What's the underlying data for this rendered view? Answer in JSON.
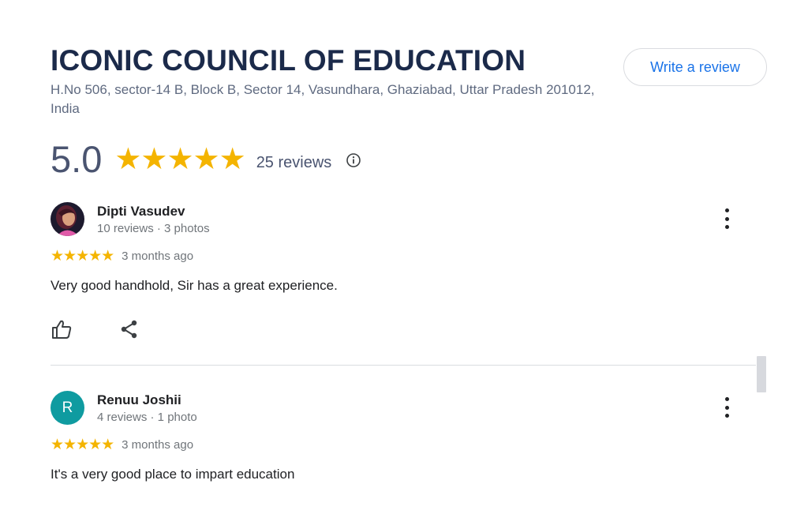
{
  "place": {
    "name": "ICONIC COUNCIL OF EDUCATION",
    "address": "H.No 506, sector-14 B, Block B, Sector 14, Vasundhara, Ghaziabad, Uttar Pradesh 201012, India"
  },
  "write_review_label": "Write a review",
  "rating": {
    "value": "5.0",
    "stars": "★★★★★",
    "count_label": "25 reviews",
    "info_icon": "info-icon"
  },
  "reviews": [
    {
      "author": "Dipti Vasudev",
      "meta": "10 reviews · 3 photos",
      "stars": "★★★★★",
      "rating": 5,
      "date": "3 months ago",
      "text": "Very good handhold, Sir has a great experience.",
      "avatar": "profile-photo"
    },
    {
      "author": "Renuu Joshii",
      "meta": "4 reviews · 1 photo",
      "avatar_letter": "R",
      "stars": "★★★★★",
      "rating": 5,
      "date": "3 months ago",
      "text": "It's a very good place to impart education"
    }
  ],
  "colors": {
    "star": "#f4b400",
    "link": "#1a73e8",
    "avatar_bg": "#0f9ba0",
    "title": "#1b2a4a"
  }
}
